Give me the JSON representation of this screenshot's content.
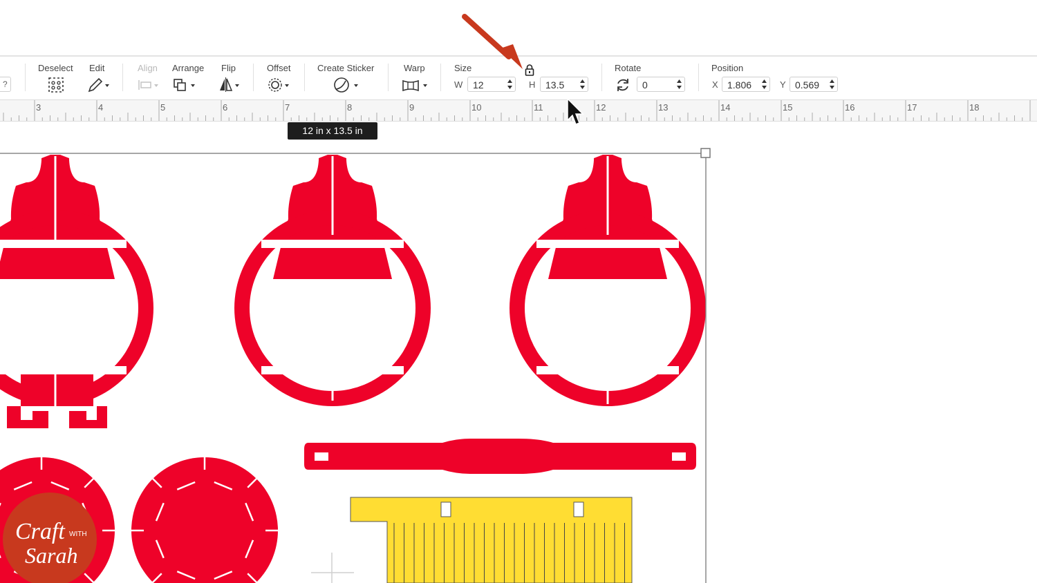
{
  "toolbar": {
    "partial_help": "?",
    "deselect": "Deselect",
    "edit": "Edit",
    "align": "Align",
    "arrange": "Arrange",
    "flip": "Flip",
    "offset": "Offset",
    "create_sticker": "Create Sticker",
    "warp": "Warp",
    "size": {
      "label": "Size",
      "w_label": "W",
      "w_value": "12",
      "h_label": "H",
      "h_value": "13.5",
      "locked": true
    },
    "rotate": {
      "label": "Rotate",
      "value": "0"
    },
    "position": {
      "label": "Position",
      "x_label": "X",
      "x_value": "1.806",
      "y_label": "Y",
      "y_value": "0.569"
    }
  },
  "ruler": {
    "numbers": [
      "3",
      "4",
      "5",
      "6",
      "7",
      "8",
      "9",
      "10",
      "11",
      "12",
      "13",
      "14",
      "15",
      "16",
      "17",
      "18"
    ]
  },
  "selection_tooltip": "12  in x 13.5  in",
  "watermark": {
    "line1": "Craft",
    "small": "WITH",
    "line2": "Sarah"
  },
  "colors": {
    "red_shape": "#EE0229",
    "yellow_shape": "#FFDD33",
    "arrow": "#C8391E",
    "tooltip_bg": "#1D1D1D"
  },
  "icons": [
    "deselect-icon",
    "edit-pencil-icon",
    "align-icon",
    "arrange-icon",
    "flip-icon",
    "offset-icon",
    "create-sticker-icon",
    "warp-icon",
    "lock-icon",
    "rotate-icon",
    "mouse-cursor-icon",
    "annotation-arrow-icon"
  ]
}
